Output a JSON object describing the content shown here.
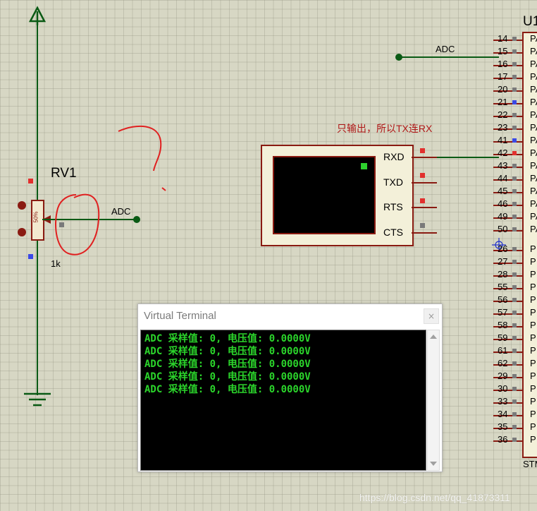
{
  "schematic": {
    "rv1_label": "RV1",
    "rv1_value": "1k",
    "rv1_position": "50%",
    "adc_net_label_left": "ADC",
    "adc_net_label_right": "ADC",
    "annotation": "只输出，所以TX连RX",
    "mcu_label": "U1",
    "mcu_bottom_label": "STM"
  },
  "mcu_pins": [
    {
      "num": "14",
      "name": "PA",
      "marker": "gray"
    },
    {
      "num": "15",
      "name": "PA",
      "marker": "gray"
    },
    {
      "num": "16",
      "name": "PA",
      "marker": "gray"
    },
    {
      "num": "17",
      "name": "PA",
      "marker": "gray"
    },
    {
      "num": "20",
      "name": "PA",
      "marker": "gray"
    },
    {
      "num": "21",
      "name": "PA",
      "marker": "blue"
    },
    {
      "num": "22",
      "name": "PA",
      "marker": "gray"
    },
    {
      "num": "23",
      "name": "PA",
      "marker": "gray"
    },
    {
      "num": "41",
      "name": "PA",
      "marker": "blue"
    },
    {
      "num": "42",
      "name": "PA",
      "marker": "red"
    },
    {
      "num": "43",
      "name": "PA",
      "marker": "gray"
    },
    {
      "num": "44",
      "name": "PA",
      "marker": "gray"
    },
    {
      "num": "45",
      "name": "PA",
      "marker": "gray"
    },
    {
      "num": "46",
      "name": "PA",
      "marker": "gray"
    },
    {
      "num": "49",
      "name": "PA",
      "marker": "gray"
    },
    {
      "num": "50",
      "name": "PA",
      "marker": "gray"
    },
    {
      "num": "26",
      "name": "P",
      "marker": "gray"
    },
    {
      "num": "27",
      "name": "P",
      "marker": "gray"
    },
    {
      "num": "28",
      "name": "P",
      "marker": "gray"
    },
    {
      "num": "55",
      "name": "P",
      "marker": "gray"
    },
    {
      "num": "56",
      "name": "P",
      "marker": "gray"
    },
    {
      "num": "57",
      "name": "P",
      "marker": "gray"
    },
    {
      "num": "58",
      "name": "P",
      "marker": "gray"
    },
    {
      "num": "59",
      "name": "P",
      "marker": "gray"
    },
    {
      "num": "61",
      "name": "P",
      "marker": "gray"
    },
    {
      "num": "62",
      "name": "P",
      "marker": "gray"
    },
    {
      "num": "29",
      "name": "P",
      "marker": "gray"
    },
    {
      "num": "30",
      "name": "P",
      "marker": "gray"
    },
    {
      "num": "33",
      "name": "P",
      "marker": "gray"
    },
    {
      "num": "34",
      "name": "P",
      "marker": "gray"
    },
    {
      "num": "35",
      "name": "P",
      "marker": "gray"
    },
    {
      "num": "36",
      "name": "P",
      "marker": "gray"
    }
  ],
  "terminal_instrument": {
    "pins": [
      "RXD",
      "TXD",
      "RTS",
      "CTS"
    ]
  },
  "virtual_terminal": {
    "title": "Virtual Terminal",
    "close_label": "×",
    "lines": [
      "ADC 采样值: 0, 电压值: 0.0000V",
      "ADC 采样值: 0, 电压值: 0.0000V",
      "ADC 采样值: 0, 电压值: 0.0000V",
      "ADC 采样值: 0, 电压值: 0.0000V",
      "ADC 采样值: 0, 电压值: 0.0000V"
    ]
  },
  "watermark": "https://blog.csdn.net/qq_41873311",
  "colors": {
    "wire": "#0a5a14",
    "component_outline": "#8a1b12",
    "terminal_text": "#2bd52b",
    "annotation_text": "#b01818",
    "sketch_red": "#e02020"
  }
}
